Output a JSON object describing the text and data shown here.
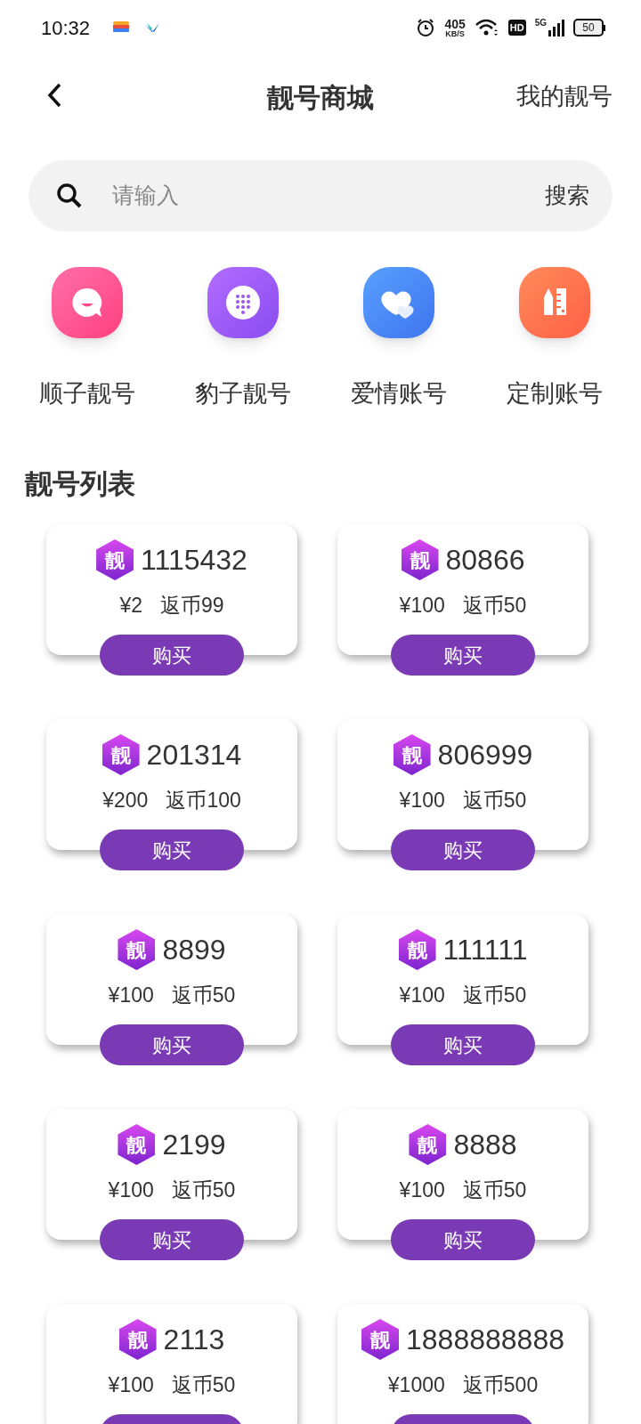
{
  "status_bar": {
    "time": "10:32",
    "speed": "405",
    "speed_unit": "KB/S",
    "network": "5G",
    "hd": "HD",
    "battery": "50"
  },
  "header": {
    "title": "靓号商城",
    "action": "我的靓号"
  },
  "search": {
    "placeholder": "请输入",
    "button": "搜索"
  },
  "categories": [
    {
      "label": "顺子靓号",
      "kind": "chat"
    },
    {
      "label": "豹子靓号",
      "kind": "dialpad"
    },
    {
      "label": "爱情账号",
      "kind": "hearts"
    },
    {
      "label": "定制账号",
      "kind": "ruler"
    }
  ],
  "section_title": "靓号列表",
  "numbers": [
    {
      "badge": "靓",
      "number": "1115432",
      "price": "¥2",
      "rebate": "返币99",
      "button": "购买"
    },
    {
      "badge": "靓",
      "number": "80866",
      "price": "¥100",
      "rebate": "返币50",
      "button": "购买"
    },
    {
      "badge": "靓",
      "number": "201314",
      "price": "¥200",
      "rebate": "返币100",
      "button": "购买"
    },
    {
      "badge": "靓",
      "number": "806999",
      "price": "¥100",
      "rebate": "返币50",
      "button": "购买"
    },
    {
      "badge": "靓",
      "number": "8899",
      "price": "¥100",
      "rebate": "返币50",
      "button": "购买"
    },
    {
      "badge": "靓",
      "number": "111111",
      "price": "¥100",
      "rebate": "返币50",
      "button": "购买"
    },
    {
      "badge": "靓",
      "number": "2199",
      "price": "¥100",
      "rebate": "返币50",
      "button": "购买"
    },
    {
      "badge": "靓",
      "number": "8888",
      "price": "¥100",
      "rebate": "返币50",
      "button": "购买"
    },
    {
      "badge": "靓",
      "number": "2113",
      "price": "¥100",
      "rebate": "返币50"
    },
    {
      "badge": "靓",
      "number": "1888888888",
      "price": "¥1000",
      "rebate": "返币500"
    }
  ]
}
